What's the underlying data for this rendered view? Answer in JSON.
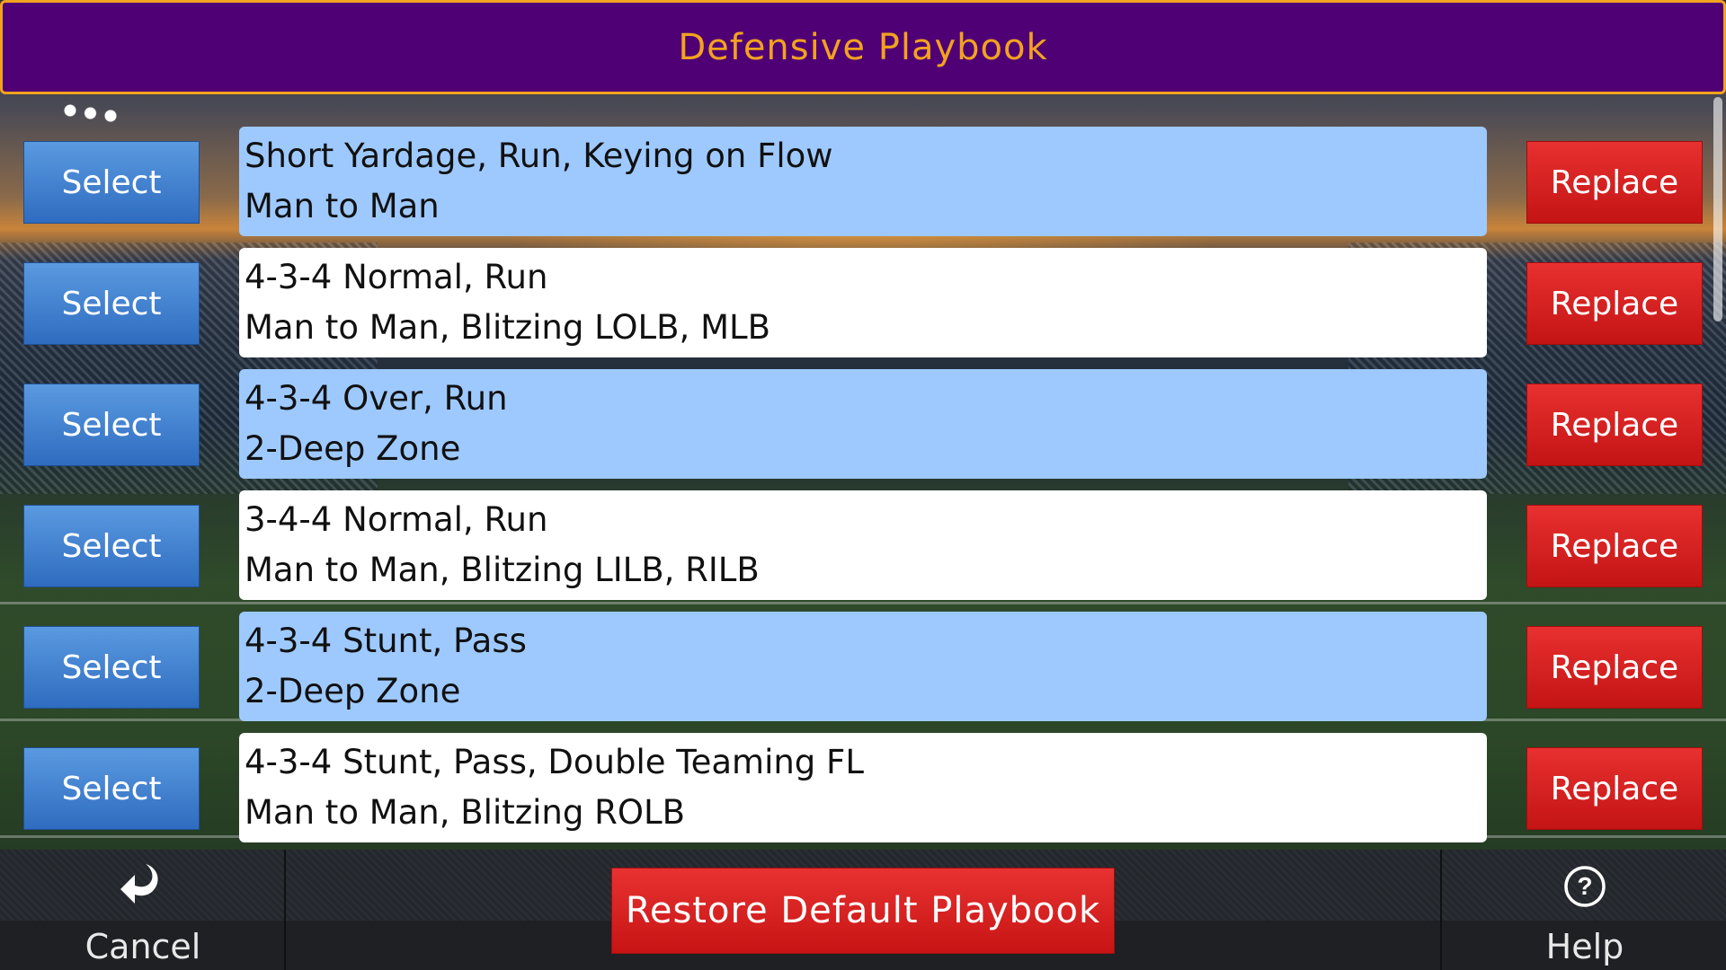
{
  "header": {
    "title": "Defensive Playbook"
  },
  "plays": [
    {
      "select_label": "Select",
      "line1": "Short Yardage, Run, Keying on Flow",
      "line2": "Man to Man",
      "replace_label": "Replace",
      "style": "blue"
    },
    {
      "select_label": "Select",
      "line1": "4-3-4 Normal, Run",
      "line2": "Man to Man, Blitzing LOLB, MLB",
      "replace_label": "Replace",
      "style": "white"
    },
    {
      "select_label": "Select",
      "line1": "4-3-4 Over, Run",
      "line2": "2-Deep Zone",
      "replace_label": "Replace",
      "style": "blue"
    },
    {
      "select_label": "Select",
      "line1": "3-4-4 Normal, Run",
      "line2": "Man to Man, Blitzing LILB, RILB",
      "replace_label": "Replace",
      "style": "white"
    },
    {
      "select_label": "Select",
      "line1": "4-3-4 Stunt, Pass",
      "line2": "2-Deep Zone",
      "replace_label": "Replace",
      "style": "blue"
    },
    {
      "select_label": "Select",
      "line1": "4-3-4 Stunt, Pass, Double Teaming FL",
      "line2": "Man to Man, Blitzing ROLB",
      "replace_label": "Replace",
      "style": "white"
    }
  ],
  "footer": {
    "cancel_label": "Cancel",
    "cancel_icon": "return-arrow-icon",
    "restore_label": "Restore Default Playbook",
    "help_label": "Help",
    "help_icon": "help-circle-icon"
  },
  "colors": {
    "title_bg": "#4f0074",
    "title_accent": "#f2a21f",
    "select_blue": "#3a78c8",
    "replace_red": "#d21e1e",
    "card_blue": "#9ec9ff",
    "card_white": "#ffffff"
  }
}
